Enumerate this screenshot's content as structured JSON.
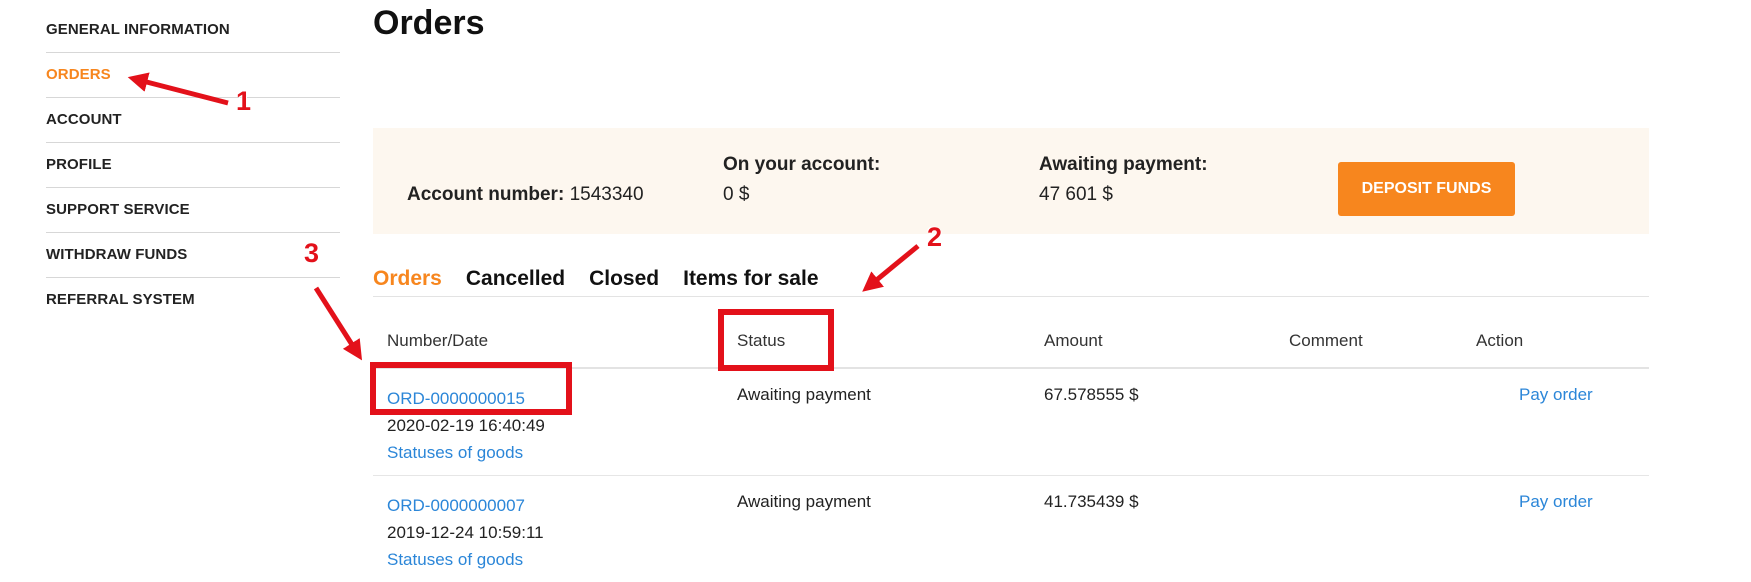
{
  "sidebar": {
    "items": [
      {
        "label": "GENERAL INFORMATION"
      },
      {
        "label": "ORDERS"
      },
      {
        "label": "ACCOUNT"
      },
      {
        "label": "PROFILE"
      },
      {
        "label": "SUPPORT SERVICE"
      },
      {
        "label": "WITHDRAW FUNDS"
      },
      {
        "label": "REFERRAL SYSTEM"
      }
    ],
    "active_index": 1
  },
  "page": {
    "title": "Orders"
  },
  "account": {
    "number_label": "Account number:",
    "number_value": "1543340",
    "on_account_label": "On your account:",
    "on_account_value": "0 $",
    "awaiting_label": "Awaiting payment:",
    "awaiting_value": "47 601 $",
    "deposit_button": "DEPOSIT FUNDS"
  },
  "tabs": [
    "Orders",
    "Cancelled",
    "Closed",
    "Items for sale"
  ],
  "table": {
    "headers": [
      "Number/Date",
      "Status",
      "Amount",
      "Comment",
      "Action"
    ],
    "rows": [
      {
        "number": "ORD-0000000015",
        "date": "2020-02-19 16:40:49",
        "goods_link": "Statuses of goods",
        "status": "Awaiting payment",
        "amount": "67.578555 $",
        "comment": "",
        "action": "Pay order"
      },
      {
        "number": "ORD-0000000007",
        "date": "2019-12-24 10:59:11",
        "goods_link": "Statuses of goods",
        "status": "Awaiting payment",
        "amount": "41.735439 $",
        "comment": "",
        "action": "Pay order"
      }
    ]
  },
  "annotations": {
    "labels": [
      "1",
      "2",
      "3"
    ]
  },
  "colors": {
    "accent": "#f7861e",
    "link": "#2b86d8",
    "annotation": "#e3111a",
    "panel_bg": "#fdf7ef"
  }
}
